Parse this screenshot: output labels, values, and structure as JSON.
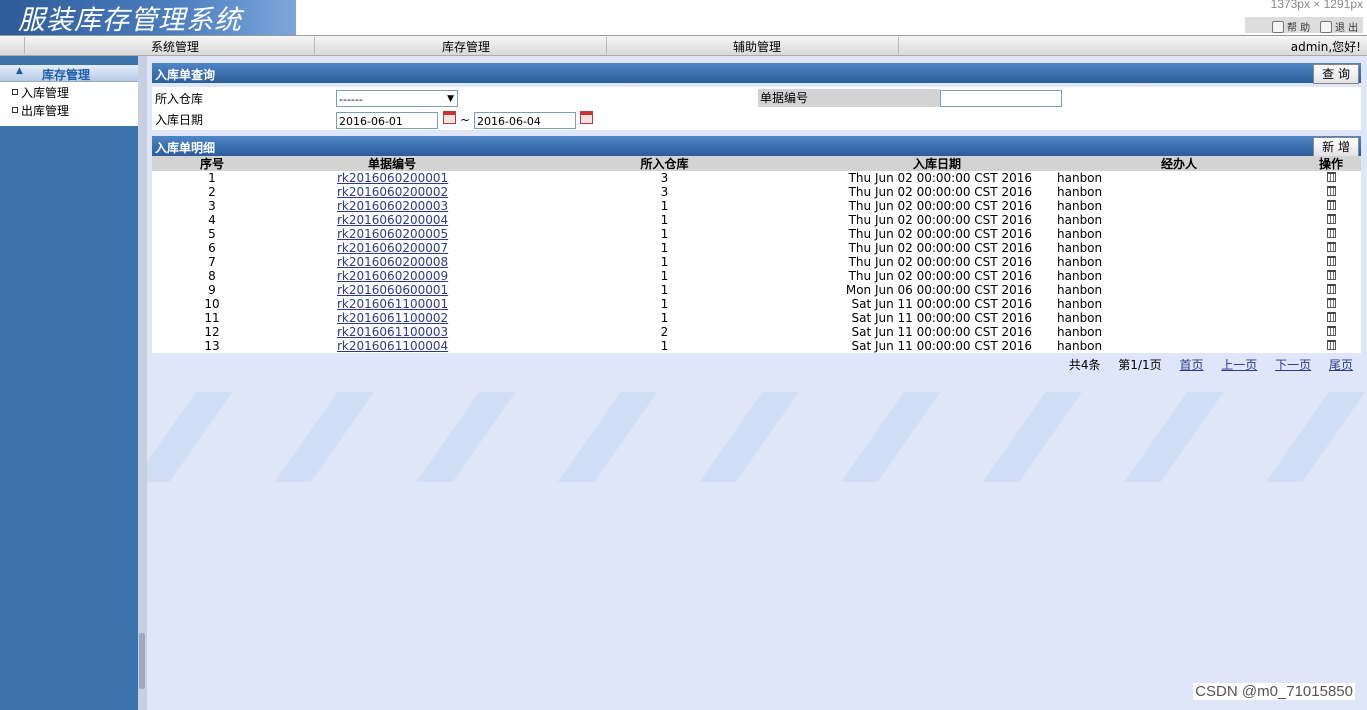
{
  "app": {
    "title": "服装库存管理系统",
    "screenshot_size_text": "1373px × 1291px"
  },
  "top_links": {
    "help": "帮 助",
    "exit": "退 出"
  },
  "menu": {
    "items": [
      "系统管理",
      "库存管理",
      "辅助管理"
    ],
    "user": "admin,您好!"
  },
  "sidebar": {
    "header": "库存管理",
    "items": [
      "入库管理",
      "出库管理"
    ]
  },
  "query": {
    "title": "入库单查询",
    "search_button": "查 询",
    "warehouse_label": "所入仓库",
    "warehouse_value": "------",
    "bill_no_label": "单据编号",
    "bill_no_value": "",
    "date_label": "入库日期",
    "date_from": "2016-06-01",
    "date_sep": "~",
    "date_to": "2016-06-04"
  },
  "list": {
    "title": "入库单明细",
    "add_button": "新 增",
    "columns": [
      "序号",
      "单据编号",
      "所入仓库",
      "入库日期",
      "经办人",
      "操作"
    ],
    "rows": [
      {
        "no": "1",
        "bill": "rk2016060200001",
        "wh": "3",
        "date": "Thu Jun 02 00:00:00 CST 2016",
        "handler": "hanbon"
      },
      {
        "no": "2",
        "bill": "rk2016060200002",
        "wh": "3",
        "date": "Thu Jun 02 00:00:00 CST 2016",
        "handler": "hanbon"
      },
      {
        "no": "3",
        "bill": "rk2016060200003",
        "wh": "1",
        "date": "Thu Jun 02 00:00:00 CST 2016",
        "handler": "hanbon"
      },
      {
        "no": "4",
        "bill": "rk2016060200004",
        "wh": "1",
        "date": "Thu Jun 02 00:00:00 CST 2016",
        "handler": "hanbon"
      },
      {
        "no": "5",
        "bill": "rk2016060200005",
        "wh": "1",
        "date": "Thu Jun 02 00:00:00 CST 2016",
        "handler": "hanbon"
      },
      {
        "no": "6",
        "bill": "rk2016060200007",
        "wh": "1",
        "date": "Thu Jun 02 00:00:00 CST 2016",
        "handler": "hanbon"
      },
      {
        "no": "7",
        "bill": "rk2016060200008",
        "wh": "1",
        "date": "Thu Jun 02 00:00:00 CST 2016",
        "handler": "hanbon"
      },
      {
        "no": "8",
        "bill": "rk2016060200009",
        "wh": "1",
        "date": "Thu Jun 02 00:00:00 CST 2016",
        "handler": "hanbon"
      },
      {
        "no": "9",
        "bill": "rk2016060600001",
        "wh": "1",
        "date": "Mon Jun 06 00:00:00 CST 2016",
        "handler": "hanbon"
      },
      {
        "no": "10",
        "bill": "rk2016061100001",
        "wh": "1",
        "date": "Sat Jun 11 00:00:00 CST 2016",
        "handler": "hanbon"
      },
      {
        "no": "11",
        "bill": "rk2016061100002",
        "wh": "1",
        "date": "Sat Jun 11 00:00:00 CST 2016",
        "handler": "hanbon"
      },
      {
        "no": "12",
        "bill": "rk2016061100003",
        "wh": "2",
        "date": "Sat Jun 11 00:00:00 CST 2016",
        "handler": "hanbon"
      },
      {
        "no": "13",
        "bill": "rk2016061100004",
        "wh": "1",
        "date": "Sat Jun 11 00:00:00 CST 2016",
        "handler": "hanbon"
      }
    ],
    "row_action_icon": "trash-icon"
  },
  "pager": {
    "total": "共4条",
    "page": "第1/1页",
    "first": "首页",
    "prev": "上一页",
    "next": "下一页",
    "last": "尾页"
  },
  "watermark": "CSDN @m0_71015850"
}
